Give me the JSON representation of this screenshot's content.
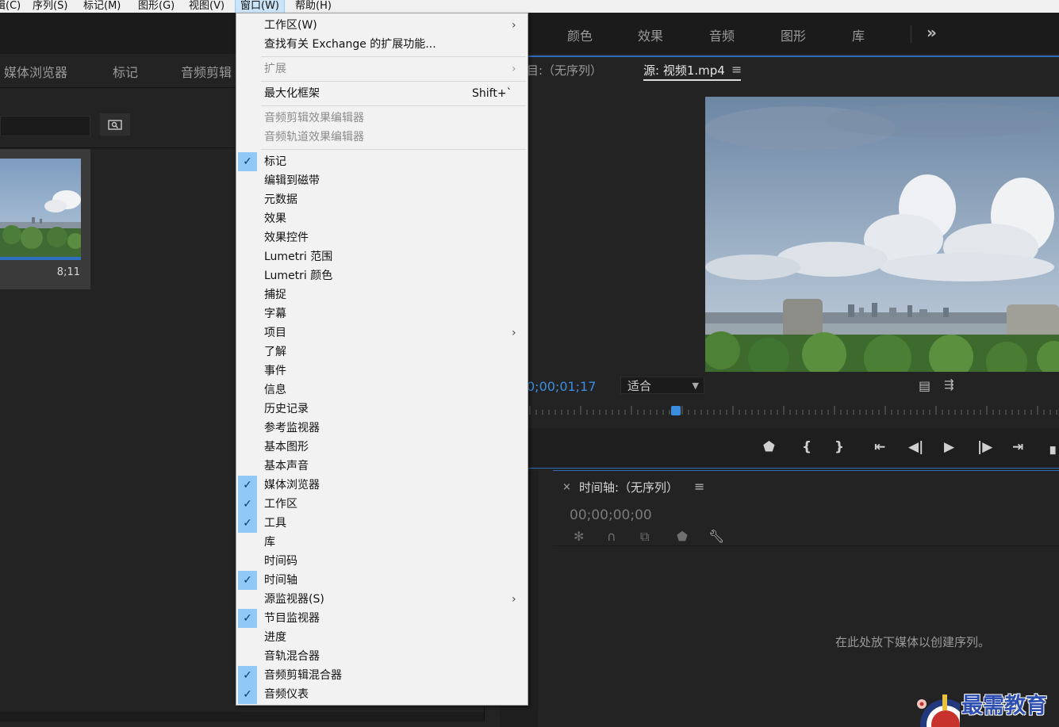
{
  "menubar": {
    "items": [
      "辑(C)",
      "序列(S)",
      "标记(M)",
      "图形(G)",
      "视图(V)",
      "窗口(W)",
      "帮助(H)"
    ]
  },
  "workspace": {
    "tabs": [
      "颜色",
      "效果",
      "音频",
      "图形",
      "库"
    ],
    "more": "»"
  },
  "left_panel": {
    "tabs": [
      "媒体浏览器",
      "标记",
      "音频剪辑"
    ],
    "clip_duration": "8;11",
    "search_icon": "search-folder-icon"
  },
  "source_monitor": {
    "program_tab": "目:（无序列）",
    "tab_label": "源: 视频1.mp4",
    "menu_icon": "≡",
    "timecode": "0;00;01;17",
    "fit_label": "适合"
  },
  "timeline": {
    "title": "时间轴:（无序列）",
    "timecode": "00;00;00;00",
    "empty_message": "在此处放下媒体以创建序列。",
    "close": "×",
    "menu_icon": "≡"
  },
  "watermark": {
    "text": "最需教育"
  },
  "dropdown": {
    "items": [
      {
        "label": "工作区(W)",
        "submenu": true
      },
      {
        "label": "查找有关 Exchange 的扩展功能..."
      },
      {
        "separator": true
      },
      {
        "label": "扩展",
        "submenu": true,
        "disabled": true
      },
      {
        "separator": true
      },
      {
        "label": "最大化框架",
        "shortcut": "Shift+`"
      },
      {
        "separator": true
      },
      {
        "label": "音频剪辑效果编辑器",
        "disabled": true
      },
      {
        "label": "音频轨道效果编辑器",
        "disabled": true
      },
      {
        "separator": true
      },
      {
        "label": "标记",
        "checked": true
      },
      {
        "label": "编辑到磁带"
      },
      {
        "label": "元数据"
      },
      {
        "label": "效果"
      },
      {
        "label": "效果控件"
      },
      {
        "label": "Lumetri 范围"
      },
      {
        "label": "Lumetri 颜色"
      },
      {
        "label": "捕捉"
      },
      {
        "label": "字幕"
      },
      {
        "label": "项目",
        "submenu": true
      },
      {
        "label": "了解"
      },
      {
        "label": "事件"
      },
      {
        "label": "信息"
      },
      {
        "label": "历史记录"
      },
      {
        "label": "参考监视器"
      },
      {
        "label": "基本图形"
      },
      {
        "label": "基本声音"
      },
      {
        "label": "媒体浏览器",
        "checked": true
      },
      {
        "label": "工作区",
        "checked": true
      },
      {
        "label": "工具",
        "checked": true
      },
      {
        "label": "库"
      },
      {
        "label": "时间码"
      },
      {
        "label": "时间轴",
        "checked": true
      },
      {
        "label": "源监视器(S)",
        "submenu": true
      },
      {
        "label": "节目监视器",
        "checked": true
      },
      {
        "label": "进度"
      },
      {
        "label": "音轨混合器"
      },
      {
        "label": "音频剪辑混合器",
        "checked": true
      },
      {
        "label": "音频仪表",
        "checked": true
      }
    ]
  }
}
